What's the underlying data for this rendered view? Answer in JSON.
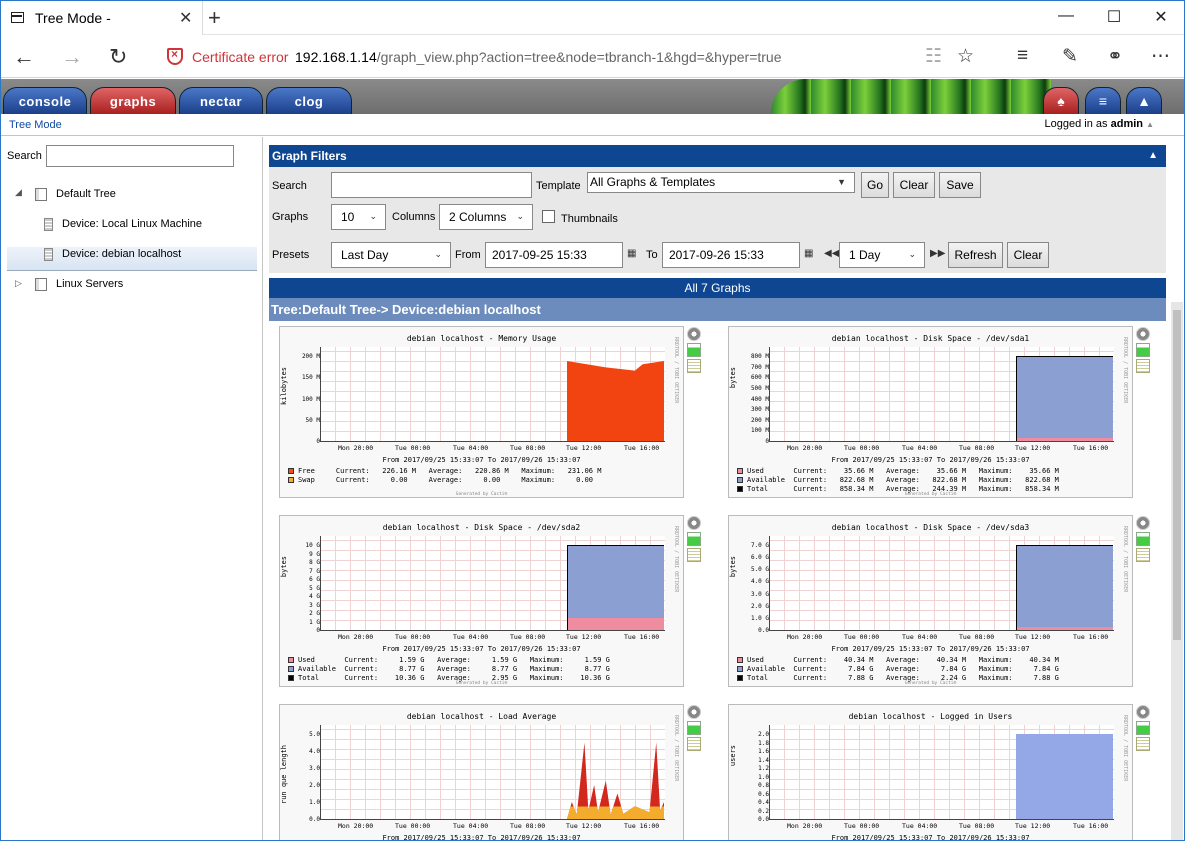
{
  "browser": {
    "tab_title": "Tree Mode -",
    "tab_close": "✕",
    "new_tab": "+",
    "cert_label": "Certificate error",
    "url_host": "192.168.1.14",
    "url_rest": "/graph_view.php?action=tree&node=tbranch-1&hgd=&hyper=true"
  },
  "cacti": {
    "tabs": [
      {
        "label": "console",
        "color": "#1c3f8a"
      },
      {
        "label": "graphs",
        "color": "#a82020"
      },
      {
        "label": "nectar",
        "color": "#1c3f8a"
      },
      {
        "label": "clog",
        "color": "#1c3f8a"
      }
    ],
    "breadcrumb": "Tree Mode",
    "logged_prefix": "Logged in as",
    "logged_user": "admin"
  },
  "tree": {
    "search_label": "Search",
    "items": [
      {
        "label": "Default Tree"
      },
      {
        "label": "Device: Local Linux Machine"
      },
      {
        "label": "Device: debian localhost"
      },
      {
        "label": "Linux Servers"
      }
    ]
  },
  "filters": {
    "title": "Graph Filters",
    "search_label": "Search",
    "search_value": "",
    "template_label": "Template",
    "template_value": "All Graphs & Templates",
    "go": "Go",
    "clear": "Clear",
    "save": "Save",
    "graphs_label": "Graphs",
    "graphs_value": "10",
    "columns_label": "Columns",
    "columns_value": "2 Columns",
    "thumbnails_label": "Thumbnails",
    "presets_label": "Presets",
    "presets_value": "Last Day",
    "from_label": "From",
    "from_value": "2017-09-25 15:33",
    "to_label": "To",
    "to_value": "2017-09-26 15:33",
    "span_value": "1 Day",
    "refresh": "Refresh",
    "clear2": "Clear"
  },
  "results": {
    "count_title": "All 7 Graphs",
    "tree_path": "Tree:Default Tree-> Device:debian localhost"
  },
  "graphs": [
    {
      "title": "debian localhost - Memory Usage",
      "ylabel": "kilobytes",
      "yticks": [
        "200 M",
        "150 M",
        "100 M",
        "50 M",
        "0"
      ],
      "range": "From 2017/09/25 15:33:07 To 2017/09/26 15:33:07",
      "legend": [
        {
          "color": "#f24f11",
          "text": "Free     Current:   226.16 M   Average:   220.86 M   Maximum:   231.06 M"
        },
        {
          "color": "#f4ac2c",
          "text": "Swap     Current:     0.00     Average:     0.00     Maximum:     0.00"
        }
      ],
      "fill": "#f24411"
    },
    {
      "title": "debian localhost - Disk Space - /dev/sda1",
      "ylabel": "bytes",
      "yticks": [
        "800 M",
        "700 M",
        "600 M",
        "500 M",
        "400 M",
        "300 M",
        "200 M",
        "100 M",
        "0"
      ],
      "range": "From 2017/09/25 15:33:07 To 2017/09/26 15:33:07",
      "legend": [
        {
          "color": "#f08ca0",
          "text": "Used       Current:    35.66 M   Average:    35.66 M   Maximum:    35.66 M"
        },
        {
          "color": "#8c9fd2",
          "text": "Available  Current:   822.68 M   Average:   822.68 M   Maximum:   822.68 M"
        },
        {
          "color": "#000000",
          "text": "Total      Current:   858.34 M   Average:   244.39 M   Maximum:   858.34 M"
        }
      ],
      "fill": "#8c9fd2"
    },
    {
      "title": "debian localhost - Disk Space - /dev/sda2",
      "ylabel": "bytes",
      "yticks": [
        "10 G",
        "9 G",
        "8 G",
        "7 G",
        "6 G",
        "5 G",
        "4 G",
        "3 G",
        "2 G",
        "1 G",
        "0"
      ],
      "range": "From 2017/09/25 15:33:07 To 2017/09/26 15:33:07",
      "legend": [
        {
          "color": "#f08ca0",
          "text": "Used       Current:     1.59 G   Average:     1.59 G   Maximum:     1.59 G"
        },
        {
          "color": "#8c9fd2",
          "text": "Available  Current:     8.77 G   Average:     8.77 G   Maximum:     8.77 G"
        },
        {
          "color": "#000000",
          "text": "Total      Current:    10.36 G   Average:     2.95 G   Maximum:    10.36 G"
        }
      ],
      "fill": "#8c9fd2"
    },
    {
      "title": "debian localhost - Disk Space - /dev/sda3",
      "ylabel": "bytes",
      "yticks": [
        "7.0 G",
        "6.0 G",
        "5.0 G",
        "4.0 G",
        "3.0 G",
        "2.0 G",
        "1.0 G",
        "0.0"
      ],
      "range": "From 2017/09/25 15:33:07 To 2017/09/26 15:33:07",
      "legend": [
        {
          "color": "#f08ca0",
          "text": "Used       Current:    40.34 M   Average:    40.34 M   Maximum:    40.34 M"
        },
        {
          "color": "#8c9fd2",
          "text": "Available  Current:     7.84 G   Average:     7.84 G   Maximum:     7.84 G"
        },
        {
          "color": "#000000",
          "text": "Total      Current:     7.88 G   Average:     2.24 G   Maximum:     7.88 G"
        }
      ],
      "fill": "#8c9fd2"
    },
    {
      "title": "debian localhost - Load Average",
      "ylabel": "run que length",
      "yticks": [
        "5.0",
        "4.0",
        "3.0",
        "2.0",
        "1.0",
        "0.0"
      ],
      "range": "From 2017/09/25 15:33:07 To 2017/09/26 15:33:07",
      "legend": [],
      "fill": "#d2281e"
    },
    {
      "title": "debian localhost - Logged in Users",
      "ylabel": "users",
      "yticks": [
        "2.0",
        "1.8",
        "1.6",
        "1.4",
        "1.2",
        "1.0",
        "0.8",
        "0.6",
        "0.4",
        "0.2",
        "0.0"
      ],
      "range": "From 2017/09/25 15:33:07 To 2017/09/26 15:33:07",
      "legend": [],
      "fill": "#94a8e8"
    }
  ],
  "xticks": [
    "Mon 20:00",
    "Tue 00:00",
    "Tue 04:00",
    "Tue 08:00",
    "Tue 12:00",
    "Tue 16:00"
  ],
  "side_text": "RRDTOOL / TOBI OETIKER",
  "generated": "Generated by Cacti®"
}
